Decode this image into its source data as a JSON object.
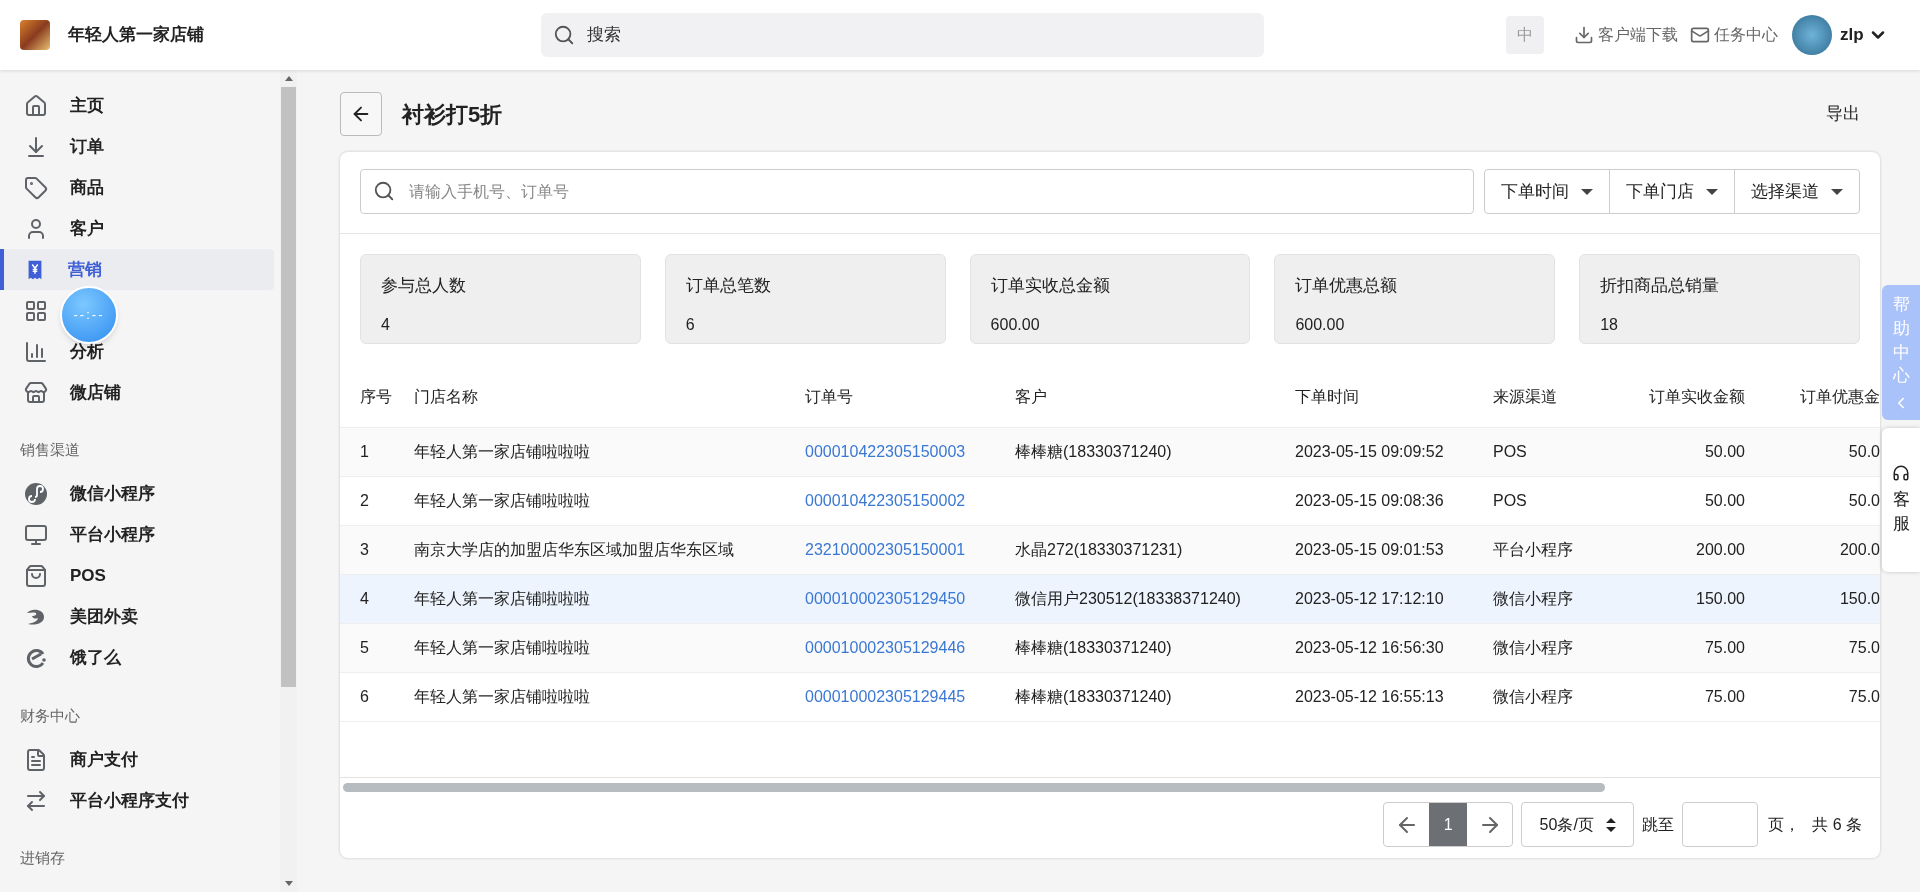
{
  "header": {
    "store_name": "年轻人第一家店铺",
    "search": {
      "placeholder": "搜索"
    },
    "language": "中",
    "links": [
      "客户端下载",
      "任务中心"
    ],
    "user": "zlp"
  },
  "sidebar": {
    "sections": [
      {
        "items": [
          {
            "label": "主页",
            "selected": false
          },
          {
            "label": "订单",
            "selected": false
          },
          {
            "label": "商品",
            "selected": false
          },
          {
            "label": "客户",
            "selected": false
          },
          {
            "label": "营销",
            "selected": true
          },
          {
            "selected": false
          },
          {
            "label": "分析",
            "selected": false
          },
          {
            "label": "微店铺",
            "selected": false
          }
        ]
      },
      {
        "title": "销售渠道",
        "items": [
          {
            "label": "微信小程序",
            "selected": false
          },
          {
            "label": "平台小程序",
            "selected": false
          },
          {
            "label": "POS",
            "selected": false
          },
          {
            "label": "美团外卖",
            "selected": false
          },
          {
            "label": "饿了么",
            "selected": false
          }
        ]
      },
      {
        "title": "财务中心",
        "items": [
          {
            "label": "商户支付",
            "selected": false
          },
          {
            "label": "平台小程序支付",
            "selected": false
          }
        ]
      },
      {
        "title": "进销存"
      }
    ]
  },
  "floating_timer": "--:--",
  "page": {
    "title": "衬衫打5折",
    "export": "导出"
  },
  "filters": {
    "search": {
      "placeholder": "请输入手机号、订单号"
    },
    "dropdowns": [
      "下单时间",
      "下单门店",
      "选择渠道"
    ]
  },
  "stats": [
    {
      "label": "参与总人数",
      "value": "4"
    },
    {
      "label": "订单总笔数",
      "value": "6"
    },
    {
      "label": "订单实收总金额",
      "value": "600.00"
    },
    {
      "label": "订单优惠总额",
      "value": "600.00"
    },
    {
      "label": "折扣商品总销量",
      "value": "18"
    }
  ],
  "table": {
    "columns": [
      "序号",
      "门店名称",
      "订单号",
      "客户",
      "下单时间",
      "来源渠道",
      "订单实收金额",
      "订单优惠金"
    ],
    "rows": [
      {
        "selected": false,
        "cells": [
          "1",
          "年轻人第一家店铺啦啦啦",
          "000010422305150003",
          "棒棒糖(18330371240)",
          "2023-05-15 09:09:52",
          "POS",
          "50.00",
          "50.0"
        ]
      },
      {
        "selected": false,
        "cells": [
          "2",
          "年轻人第一家店铺啦啦啦",
          "000010422305150002",
          "",
          "2023-05-15 09:08:36",
          "POS",
          "50.00",
          "50.0"
        ]
      },
      {
        "selected": false,
        "cells": [
          "3",
          "南京大学店的加盟店华东区域加盟店华东区域",
          "232100002305150001",
          "水晶272(18330371231)",
          "2023-05-15 09:01:53",
          "平台小程序",
          "200.00",
          "200.0"
        ]
      },
      {
        "selected": true,
        "cells": [
          "4",
          "年轻人第一家店铺啦啦啦",
          "000010002305129450",
          "微信用户230512(18338371240)",
          "2023-05-12 17:12:10",
          "微信小程序",
          "150.00",
          "150.0"
        ]
      },
      {
        "selected": false,
        "cells": [
          "5",
          "年轻人第一家店铺啦啦啦",
          "000010002305129446",
          "棒棒糖(18330371240)",
          "2023-05-12 16:56:30",
          "微信小程序",
          "75.00",
          "75.0"
        ]
      },
      {
        "selected": false,
        "cells": [
          "6",
          "年轻人第一家店铺啦啦啦",
          "000010002305129445",
          "棒棒糖(18330371240)",
          "2023-05-12 16:55:13",
          "微信小程序",
          "75.00",
          "75.0"
        ]
      }
    ]
  },
  "pagination": {
    "pages": [
      {
        "label": "1",
        "selected": true
      }
    ],
    "page_size": "50条/页",
    "jump_label": "跳至",
    "page_suffix": "页，",
    "total": "共 6 条"
  },
  "side_tabs": {
    "help": "帮助中心",
    "service": "客服"
  }
}
